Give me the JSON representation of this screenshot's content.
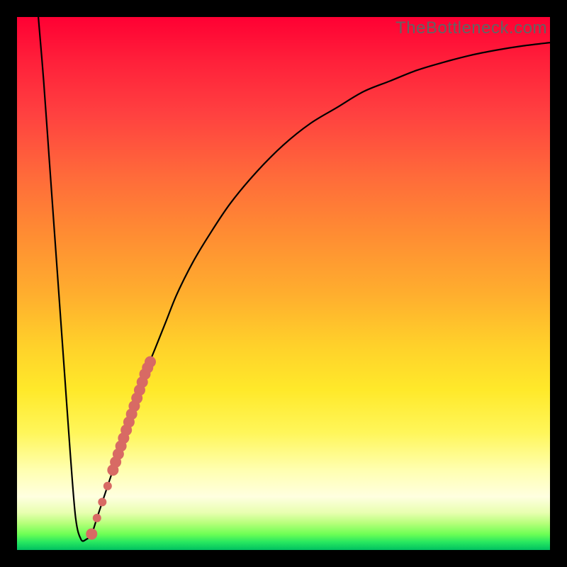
{
  "watermark": "TheBottleneck.com",
  "colors": {
    "frame": "#000000",
    "curve": "#000000",
    "marker_fill": "#d86a64",
    "marker_stroke": "#c55a54"
  },
  "chart_data": {
    "type": "line",
    "title": "",
    "xlabel": "",
    "ylabel": "",
    "xlim": [
      0,
      100
    ],
    "ylim": [
      0,
      100
    ],
    "series": [
      {
        "name": "bottleneck-curve",
        "x": [
          4,
          5,
          6,
          7,
          8,
          9,
          10,
          11,
          12,
          13,
          14,
          15,
          16,
          17,
          18,
          20,
          22,
          24,
          26,
          28,
          30,
          33,
          36,
          40,
          45,
          50,
          55,
          60,
          65,
          70,
          75,
          80,
          85,
          90,
          95,
          100
        ],
        "y": [
          100,
          88,
          74,
          60,
          46,
          32,
          18,
          6,
          2,
          2,
          3,
          6,
          9,
          12,
          15,
          21,
          27,
          33,
          38,
          43,
          48,
          54,
          59,
          65,
          71,
          76,
          80,
          83,
          86,
          88,
          90,
          91.5,
          92.8,
          93.8,
          94.6,
          95.2
        ]
      }
    ],
    "markers": {
      "name": "highlight-points",
      "x": [
        14.0,
        15.0,
        16.0,
        17.0,
        18.0,
        18.5,
        19.0,
        19.5,
        20.0,
        20.5,
        21.0,
        21.5,
        22.0,
        22.5,
        23.0,
        23.5,
        24.0,
        24.5,
        25.0
      ],
      "y": [
        3.0,
        6.0,
        9.0,
        12.0,
        15.0,
        16.5,
        18.0,
        19.5,
        21.0,
        22.5,
        24.0,
        25.5,
        27.0,
        28.5,
        30.0,
        31.5,
        33.0,
        34.2,
        35.3
      ],
      "radius": [
        8,
        6,
        6,
        6,
        8,
        8,
        8,
        8,
        8,
        8,
        8,
        8,
        8,
        8,
        8,
        8,
        8,
        8,
        8
      ]
    },
    "background_gradient_note": "red top to green bottom indicating severity"
  }
}
